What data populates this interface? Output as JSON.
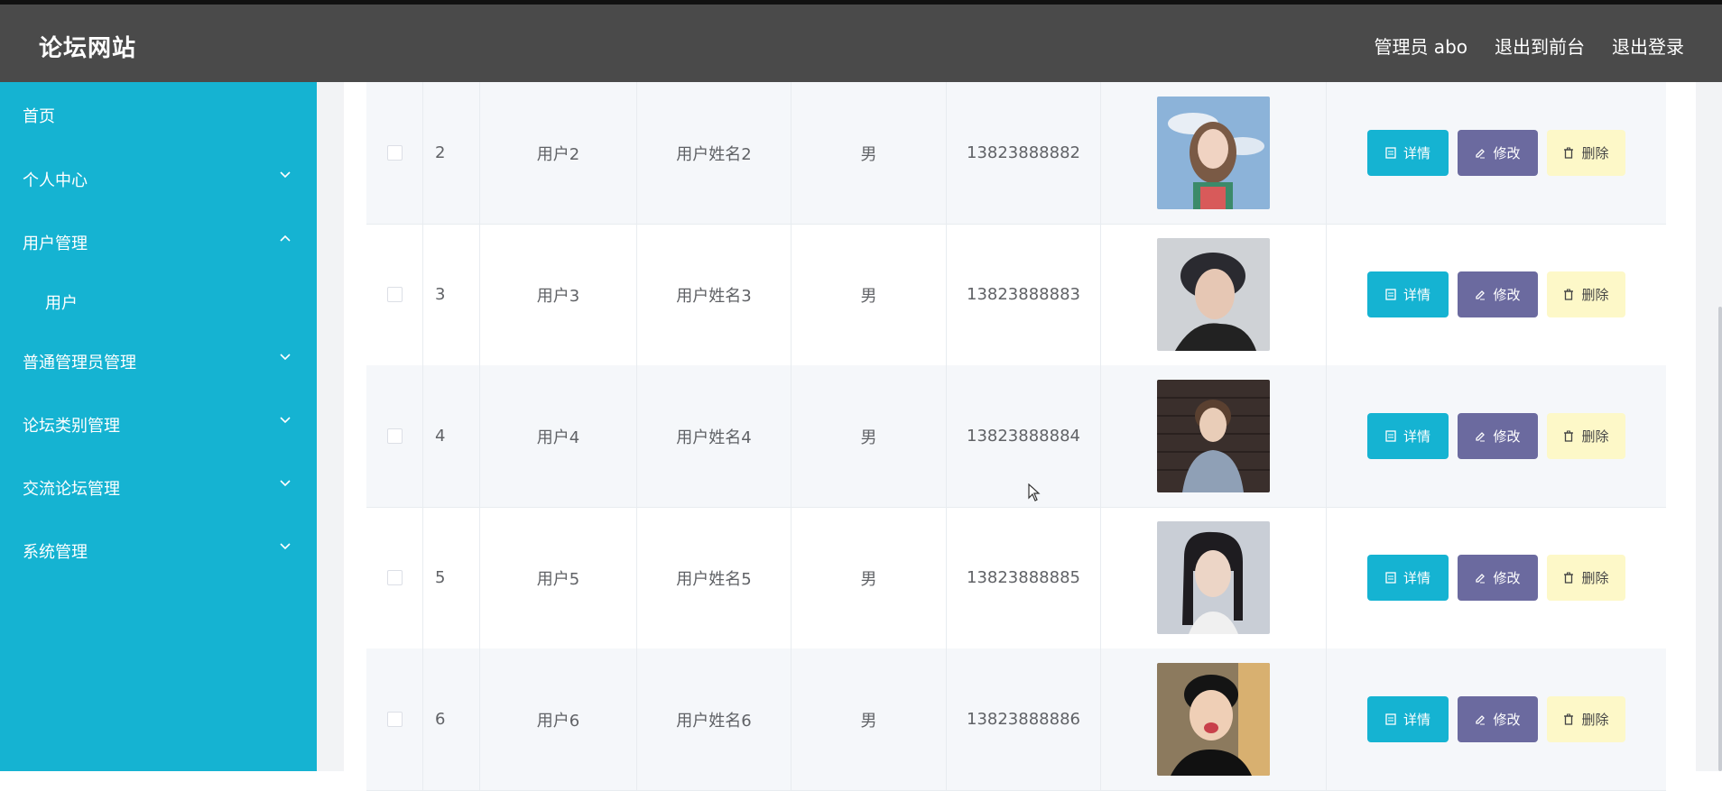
{
  "header": {
    "title": "论坛网站",
    "admin_label": "管理员 abo",
    "to_front": "退出到前台",
    "logout": "退出登录"
  },
  "sidebar": {
    "items": [
      {
        "label": "首页"
      },
      {
        "label": "个人中心",
        "chevron": "down"
      },
      {
        "label": "用户管理",
        "chevron": "up",
        "children": [
          {
            "label": "用户"
          }
        ]
      },
      {
        "label": "普通管理员管理",
        "chevron": "down"
      },
      {
        "label": "论坛类别管理",
        "chevron": "down"
      },
      {
        "label": "交流论坛管理",
        "chevron": "down"
      },
      {
        "label": "系统管理",
        "chevron": "down"
      }
    ]
  },
  "table": {
    "rows": [
      {
        "index": "2",
        "account": "用户2",
        "name": "用户姓名2",
        "sex": "男",
        "phone": "13823888882",
        "photo": "woman-short-hair-avatar"
      },
      {
        "index": "3",
        "account": "用户3",
        "name": "用户姓名3",
        "sex": "男",
        "phone": "13823888883",
        "photo": "man-dark-hair-avatar"
      },
      {
        "index": "4",
        "account": "用户4",
        "name": "用户姓名4",
        "sex": "男",
        "phone": "13823888884",
        "photo": "young-man-brick-wall-avatar"
      },
      {
        "index": "5",
        "account": "用户5",
        "name": "用户姓名5",
        "sex": "男",
        "phone": "13823888885",
        "photo": "woman-long-hair-avatar"
      },
      {
        "index": "6",
        "account": "用户6",
        "name": "用户姓名6",
        "sex": "男",
        "phone": "13823888886",
        "photo": "man-funny-face-avatar"
      }
    ],
    "actions": {
      "detail": "详情",
      "edit": "修改",
      "delete": "删除"
    }
  },
  "colors": {
    "header_bg": "#4a4a4a",
    "sidebar_bg": "#15b3d2",
    "detail_btn": "#15b3d2",
    "edit_btn": "#6b6a9f",
    "delete_btn": "#fdf8c8"
  }
}
